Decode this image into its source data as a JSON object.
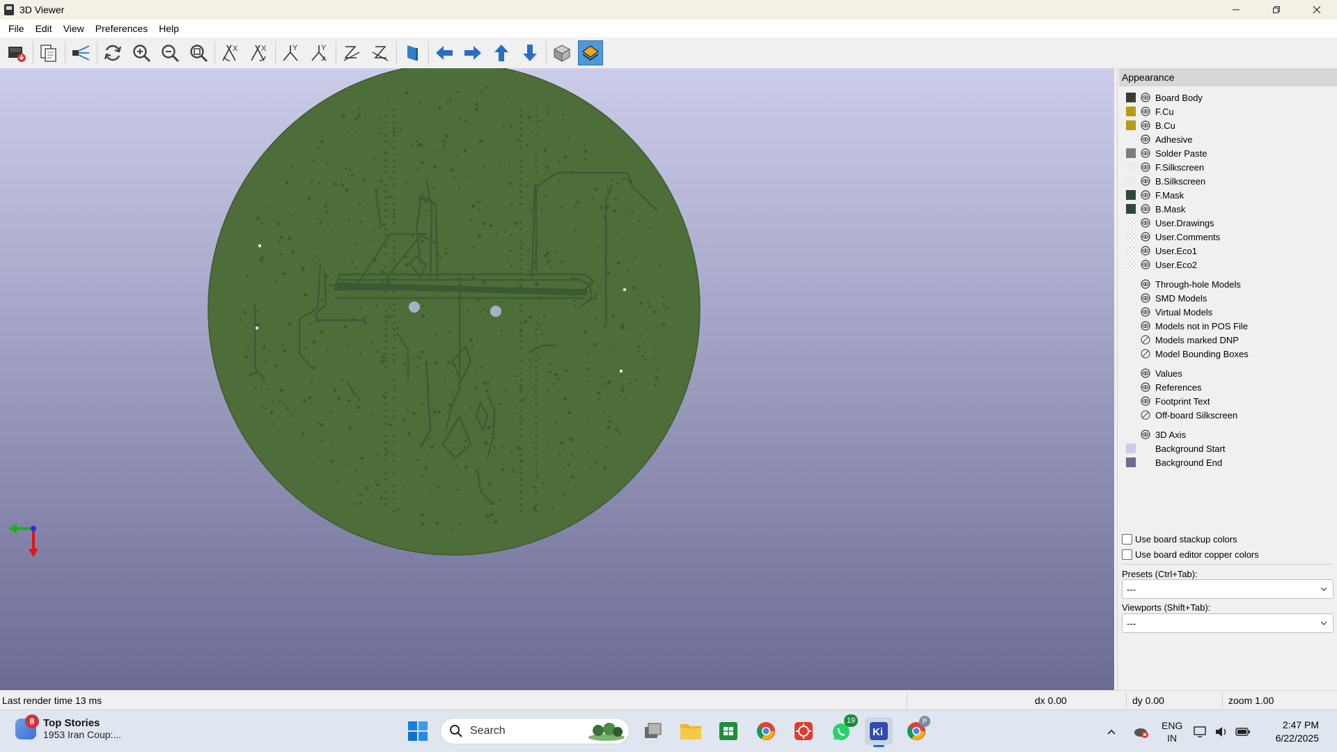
{
  "window": {
    "title": "3D Viewer"
  },
  "menu": [
    "File",
    "Edit",
    "View",
    "Preferences",
    "Help"
  ],
  "toolbar": {
    "buttons": [
      "export-icon",
      "copy-icon",
      "raytrace-icon",
      "reload-icon",
      "zoom-in-icon",
      "zoom-out-icon",
      "zoom-fit-icon",
      "rotate-x-cw-icon",
      "rotate-x-ccw-icon",
      "rotate-y-cw-icon",
      "rotate-y-ccw-icon",
      "rotate-z-cw-icon",
      "rotate-z-ccw-icon",
      "flip-board-icon",
      "arrow-left-icon",
      "arrow-right-icon",
      "arrow-up-icon",
      "arrow-down-icon",
      "ortho-icon",
      "layers-icon"
    ],
    "active": "layers-icon"
  },
  "appearance": {
    "title": "Appearance",
    "layers": [
      {
        "label": "Board Body",
        "color": "#403a32",
        "eye": "visible"
      },
      {
        "label": "F.Cu",
        "color": "#b59c13",
        "eye": "visible"
      },
      {
        "label": "B.Cu",
        "color": "#b59c13",
        "eye": "visible"
      },
      {
        "label": "Adhesive",
        "color": "",
        "eye": "visible"
      },
      {
        "label": "Solder Paste",
        "color": "#7d7d7d",
        "eye": "visible"
      },
      {
        "label": "F.Silkscreen",
        "color": "#ececec",
        "eye": "visible"
      },
      {
        "label": "B.Silkscreen",
        "color": "#ececec",
        "eye": "visible"
      },
      {
        "label": "F.Mask",
        "color": "#2c4a36",
        "eye": "visible"
      },
      {
        "label": "B.Mask",
        "color": "#2c4a36",
        "eye": "visible"
      },
      {
        "label": "User.Drawings",
        "color": "checker",
        "eye": "visible"
      },
      {
        "label": "User.Comments",
        "color": "checker",
        "eye": "visible"
      },
      {
        "label": "User.Eco1",
        "color": "checker",
        "eye": "visible"
      },
      {
        "label": "User.Eco2",
        "color": "checker",
        "eye": "visible"
      }
    ],
    "models": [
      {
        "label": "Through-hole Models",
        "eye": "visible"
      },
      {
        "label": "SMD Models",
        "eye": "visible"
      },
      {
        "label": "Virtual Models",
        "eye": "visible"
      },
      {
        "label": "Models not in POS File",
        "eye": "visible"
      },
      {
        "label": "Models marked DNP",
        "eye": "hidden"
      },
      {
        "label": "Model Bounding Boxes",
        "eye": "hidden"
      }
    ],
    "texts": [
      {
        "label": "Values",
        "eye": "visible"
      },
      {
        "label": "References",
        "eye": "visible"
      },
      {
        "label": "Footprint Text",
        "eye": "visible"
      },
      {
        "label": "Off-board Silkscreen",
        "eye": "hidden"
      }
    ],
    "misc": [
      {
        "label": "3D Axis",
        "color": "",
        "eye": "visible"
      },
      {
        "label": "Background Start",
        "color": "#ccccea",
        "eye": ""
      },
      {
        "label": "Background End",
        "color": "#6b6b94",
        "eye": ""
      }
    ],
    "use_stackup_colors": "Use board stackup colors",
    "use_copper_colors": "Use board editor copper colors",
    "presets_label": "Presets (Ctrl+Tab):",
    "presets_value": "---",
    "viewports_label": "Viewports (Shift+Tab):",
    "viewports_value": "---"
  },
  "status": {
    "render_time": "Last render time 13 ms",
    "dx": "dx 0.00",
    "dy": "dy 0.00",
    "zoom": "zoom 1.00"
  },
  "taskbar": {
    "news_badge": "8",
    "news_title": "Top Stories",
    "news_subtitle": "1953 Iran Coup:...",
    "search_label": "Search",
    "whatsapp_badge": "19",
    "chrome_profile_badge": "P",
    "lang": "ENG",
    "region": "IN",
    "time": "2:47 PM",
    "date": "6/22/2025"
  },
  "colors": {
    "board": "#4e6e39",
    "trace": "#3a5a32",
    "accent": "#4e9ad8",
    "bg_start": "#ccccea",
    "bg_end": "#6b6b94"
  }
}
